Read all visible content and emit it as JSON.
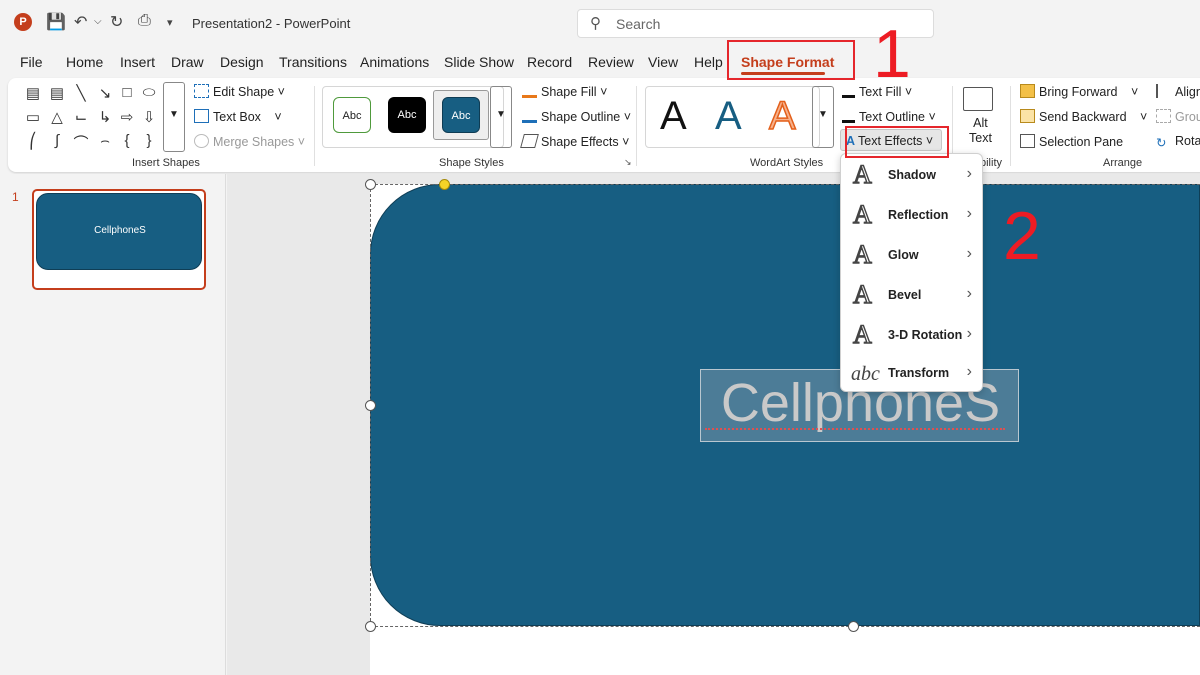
{
  "titlebar": {
    "doc_title": "Presentation2",
    "sep": "-",
    "app_name": "PowerPoint",
    "search_placeholder": "Search"
  },
  "tabs": [
    "File",
    "Home",
    "Insert",
    "Draw",
    "Design",
    "Transitions",
    "Animations",
    "Slide Show",
    "Record",
    "Review",
    "View",
    "Help",
    "Shape Format"
  ],
  "ribbon": {
    "insert_shapes": {
      "label": "Insert Shapes",
      "edit_shape": "Edit Shape",
      "text_box": "Text Box",
      "merge_shapes": "Merge Shapes"
    },
    "shape_styles": {
      "label": "Shape Styles",
      "presets": [
        "Abc",
        "Abc",
        "Abc"
      ],
      "shape_fill": "Shape Fill",
      "shape_outline": "Shape Outline",
      "shape_effects": "Shape Effects"
    },
    "wordart": {
      "label": "WordArt Styles",
      "presets": [
        "A",
        "A",
        "A"
      ],
      "text_fill": "Text Fill",
      "text_outline": "Text Outline",
      "text_effects": "Text Effects"
    },
    "accessibility": {
      "alt_text_line1": "Alt",
      "alt_text_line2": "Text",
      "label_partial": "bility"
    },
    "arrange": {
      "label": "Arrange",
      "bring_forward": "Bring Forward",
      "send_backward": "Send Backward",
      "selection_pane": "Selection Pane",
      "align": "Align",
      "group": "Grou",
      "rotate": "Rota"
    }
  },
  "thumbnail": {
    "number": "1",
    "text": "CellphoneS"
  },
  "slide": {
    "shape_text": "CellphoneS"
  },
  "text_effects_menu": [
    {
      "label": "Shadow",
      "icon": "A"
    },
    {
      "label": "Reflection",
      "icon": "A"
    },
    {
      "label": "Glow",
      "icon": "A"
    },
    {
      "label": "Bevel",
      "icon": "A"
    },
    {
      "label": "3-D Rotation",
      "icon": "A"
    },
    {
      "label": "Transform",
      "icon": "abc"
    }
  ],
  "annotations": {
    "step1": "1",
    "step2": "2"
  },
  "colors": {
    "accent_red": "#c43e1c",
    "shape_fill": "#175e82",
    "annotation_red": "#ed1c24"
  }
}
